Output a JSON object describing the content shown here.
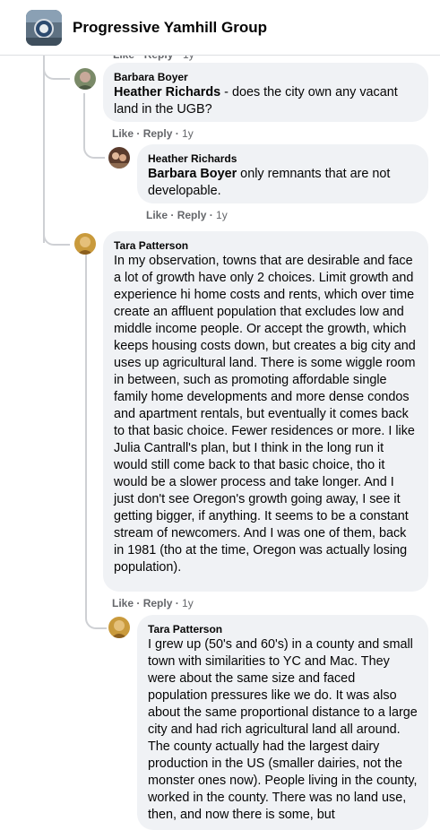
{
  "header": {
    "group_name": "Progressive Yamhill Group",
    "avatar_icon": "group-logo-icon"
  },
  "clipped_actions": {
    "like": "Like",
    "reply": "Reply",
    "time": "1y"
  },
  "comments": [
    {
      "author": "Barbara Boyer",
      "tag": "Heather Richards",
      "text": " - does the city own any vacant land in the UGB?",
      "actions": {
        "like": "Like",
        "reply": "Reply",
        "time": "1y"
      }
    },
    {
      "author": "Heather Richards",
      "tag": "Barbara Boyer",
      "text": " only remnants that are not developable.",
      "actions": {
        "like": "Like",
        "reply": "Reply",
        "time": "1y"
      }
    },
    {
      "author": "Tara Patterson",
      "text": "In my observation, towns that are desirable and face a lot of growth have only 2 choices. Limit growth and experience hi home costs and rents, which over time create an affluent population that excludes low and middle income people. Or accept the growth, which keeps housing costs down, but creates a big city and uses up agricultural land. There is some wiggle room in between, such as promoting affordable single family home developments and more dense condos and apartment rentals, but eventually it comes back to that basic choice. Fewer residences or more. I like Julia Cantrall's plan, but I think in the long run it would still come back to that basic choice, tho it would be a slower process and take longer. And I just don't see Oregon's growth going away, I see it getting bigger, if anything. It seems to be a constant stream of newcomers. And I was one of them, back in 1981 (tho at the time, Oregon was actually losing population).",
      "actions": {
        "like": "Like",
        "reply": "Reply",
        "time": "1y"
      }
    },
    {
      "author": "Tara Patterson",
      "text": "I grew up (50's and 60's) in a county and small town with similarities to YC and Mac. They were about the same size and faced population pressures like we do. It was also about the same proportional distance to a large city and had rich agricultural land all around. The county actually had the largest dairy production in the US (smaller dairies, not the monster ones now). People living in the county, worked in the county. There was no land use, then, and now there is some, but"
    }
  ],
  "separator": " · ",
  "colors": {
    "bubble_bg": "#f0f2f5",
    "meta_text": "#65676b",
    "thread_line": "#ced0d4",
    "text": "#050505"
  }
}
